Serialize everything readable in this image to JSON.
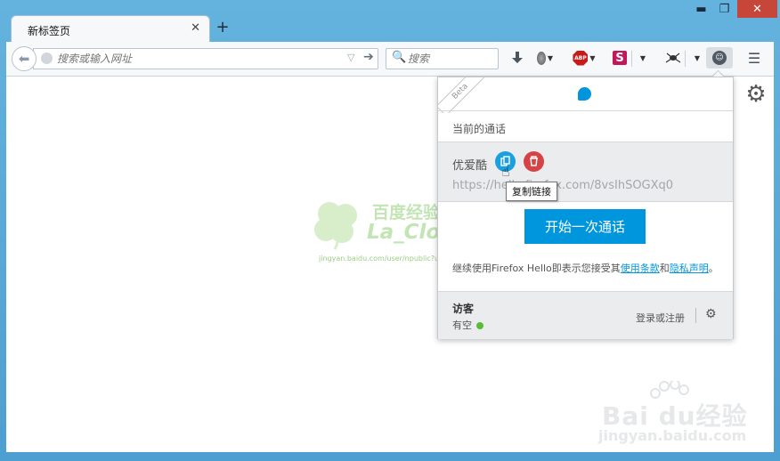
{
  "window": {
    "controls": {
      "minimize": "▬",
      "maximize": "❐",
      "close": "✕"
    }
  },
  "tabs": [
    {
      "title": "新标签页",
      "close": "✕"
    }
  ],
  "new_tab": "+",
  "toolbar": {
    "back": "⬅",
    "url_placeholder": "搜索或输入网址",
    "url_drop": "▽",
    "go": "➔",
    "search_placeholder": "搜索",
    "search_icon": "🔍",
    "download_icon": "download-icon",
    "abp_label": "ABP",
    "s_label": "S",
    "menu": "☰"
  },
  "hello_panel": {
    "beta": "Beta",
    "section_title": "当前的通话",
    "conversation": {
      "name": "优爱酷",
      "url": "https://hello.firefox.com/8vsIhSOGXq0"
    },
    "tooltip": "复制链接",
    "start_button": "开始一次通话",
    "terms_prefix": "继续使用Firefox Hello即表示您接受其",
    "terms_link": "使用条款",
    "terms_and": "和",
    "privacy_link": "隐私声明",
    "terms_suffix": "。",
    "user": {
      "name": "访客",
      "status": "有空",
      "status_color": "#57bd35"
    },
    "login": "登录或注册"
  },
  "watermarks": {
    "clover_line1": "百度经验by",
    "clover_line2": "La_Clover",
    "clover_url": "jingyan.baidu.com/user/npublic?un=La_Clover",
    "baidu_brand": "Bai du经验",
    "baidu_url": "jingyan.baidu.com"
  },
  "colors": {
    "frame": "#5aa9d6",
    "accent": "#0096dd",
    "delete": "#d74345"
  }
}
